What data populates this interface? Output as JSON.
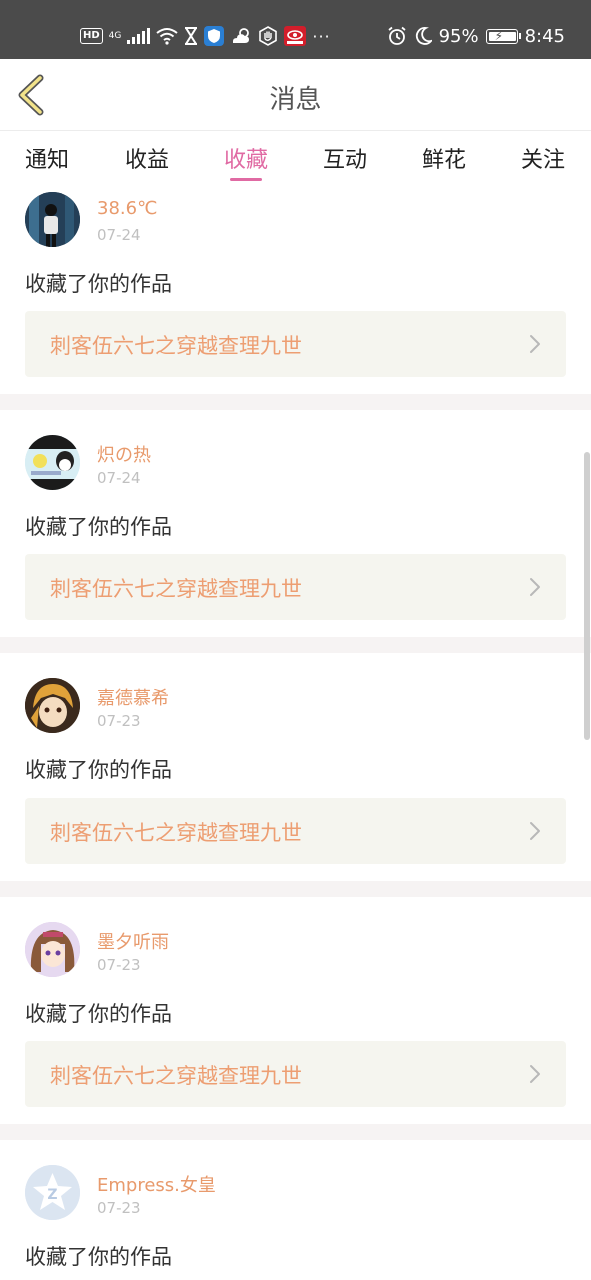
{
  "status_bar": {
    "hd": "HD",
    "network": "4G",
    "battery": "95%",
    "time": "8:45",
    "icons": [
      "wifi-icon",
      "hourglass-icon",
      "shield-app-icon",
      "weather-icon",
      "hand-icon",
      "app-badge-icon",
      "more-dots-icon",
      "alarm-icon",
      "moon-icon",
      "battery-icon"
    ]
  },
  "header": {
    "title": "消息",
    "back_icon": "chevron-left-icon"
  },
  "tabs": [
    {
      "label": "通知"
    },
    {
      "label": "收益"
    },
    {
      "label": "收藏",
      "active": true
    },
    {
      "label": "互动"
    },
    {
      "label": "鲜花"
    },
    {
      "label": "关注"
    }
  ],
  "messages": [
    {
      "name": "38.6℃",
      "date": "07-24",
      "action": "收藏了你的作品",
      "work": "刺客伍六七之穿越查理九世"
    },
    {
      "name": "炽の热",
      "date": "07-24",
      "action": "收藏了你的作品",
      "work": "刺客伍六七之穿越查理九世"
    },
    {
      "name": "嘉德慕希",
      "date": "07-23",
      "action": "收藏了你的作品",
      "work": "刺客伍六七之穿越查理九世"
    },
    {
      "name": "墨夕听雨",
      "date": "07-23",
      "action": "收藏了你的作品",
      "work": "刺客伍六七之穿越查理九世"
    },
    {
      "name": "Empress.女皇",
      "date": "07-23",
      "action": "收藏了你的作品"
    }
  ],
  "colors": {
    "accent": "#e06aa3",
    "username": "#e89a6c",
    "work_title": "#ed9e72",
    "work_box": "#f5f5ef",
    "status_bar": "#4b4b4b"
  }
}
